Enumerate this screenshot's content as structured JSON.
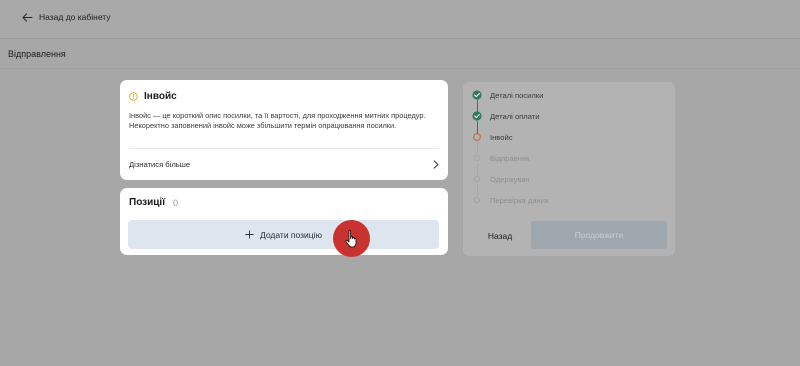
{
  "header": {
    "back_label": "Назад до кабінету"
  },
  "section": {
    "title": "Відправлення"
  },
  "invoice": {
    "title": "Інвойс",
    "description": "Інвойс — це короткий опис посилки, та її вартості, для проходження митних процедур. Некоректно заповнений інвойс може збільшити термін опрацювання посилки.",
    "learn_more": "Дізнатися більше"
  },
  "positions": {
    "title": "Позиції",
    "count": "0",
    "add_label": "Додати позицію"
  },
  "steps": {
    "items": [
      {
        "label": "Деталі посилки",
        "state": "done"
      },
      {
        "label": "Деталі оплати",
        "state": "done"
      },
      {
        "label": "Інвойс",
        "state": "current"
      },
      {
        "label": "Відправник",
        "state": "pending"
      },
      {
        "label": "Одержувач",
        "state": "pending"
      },
      {
        "label": "Перевірка даних",
        "state": "pending"
      }
    ],
    "back_label": "Назад",
    "continue_label": "Продовжити"
  },
  "colors": {
    "done": "#2f7d58",
    "current": "#c26a3c",
    "accent_red": "#c8322f",
    "warning": "#e0a41e"
  }
}
